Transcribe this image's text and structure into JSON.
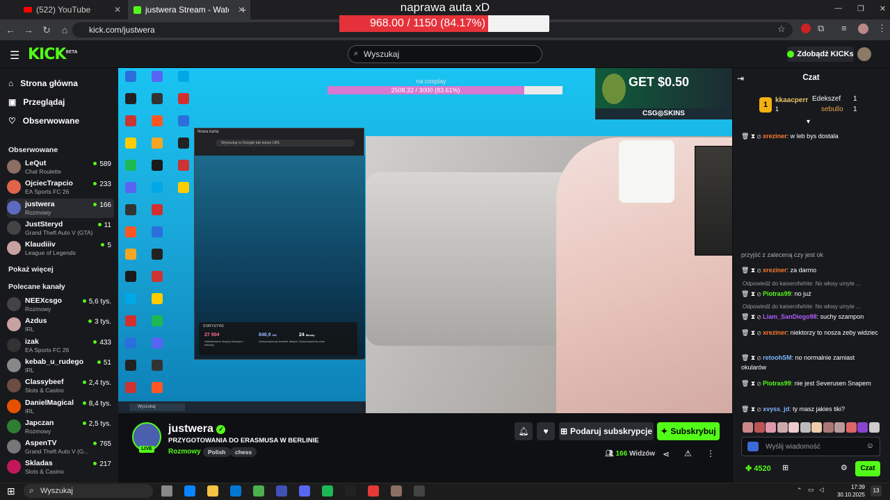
{
  "browser": {
    "tabs": [
      {
        "label": "(522) YouTube",
        "active": false
      },
      {
        "label": "justwera Stream - Watch Live o",
        "active": true
      }
    ],
    "new_tab_glyph": "+",
    "url": "kick.com/justwera"
  },
  "overlay_goal": {
    "title": "naprawa auta xD",
    "progress_text": "968.00 / 1150 (84.17%)",
    "progress": 0.8417,
    "bar_color": "#e5323a"
  },
  "kick": {
    "logo": "KICK",
    "logo_badge": "BETA",
    "search_placeholder": "Wyszukaj",
    "kicks_button": "Zdobądź KICKs",
    "accent": "#53fc18"
  },
  "sidebar": {
    "nav": [
      {
        "icon": "home-icon",
        "label": "Strona główna"
      },
      {
        "icon": "browse-icon",
        "label": "Przeglądaj"
      },
      {
        "icon": "heart-icon",
        "label": "Obserwowane"
      }
    ],
    "followed_heading": "Obserwowane",
    "followed": [
      {
        "name": "LeQut",
        "category": "Chat Roulette",
        "viewers": "589"
      },
      {
        "name": "OjciecTrapcio",
        "category": "EA Sports FC 26",
        "viewers": "233"
      },
      {
        "name": "justwera",
        "category": "Rozmowy",
        "viewers": "166"
      },
      {
        "name": "JustSteryd",
        "category": "Grand Theft Auto V (GTA)",
        "viewers": "11"
      },
      {
        "name": "Klaudiiiv",
        "category": "League of Legends",
        "viewers": "5"
      }
    ],
    "show_more": "Pokaż więcej",
    "recommended_heading": "Polecane kanały",
    "recommended": [
      {
        "name": "NEEXcsgo",
        "category": "Rozmowy",
        "viewers": "5,6 tys."
      },
      {
        "name": "Azdus",
        "category": "IRL",
        "viewers": "3 tys."
      },
      {
        "name": "izak",
        "category": "EA Sports FC 26",
        "viewers": "433"
      },
      {
        "name": "kebab_u_rudego",
        "category": "IRL",
        "viewers": "51"
      },
      {
        "name": "Classybeef",
        "category": "Slots & Casino",
        "viewers": "2,4 tys."
      },
      {
        "name": "DanielMagical",
        "category": "IRL",
        "viewers": "8,4 tys."
      },
      {
        "name": "Japczan",
        "category": "Rozmowy",
        "viewers": "2,5 tys."
      },
      {
        "name": "AspenTV",
        "category": "Grand Theft Auto V (G...",
        "viewers": "765"
      },
      {
        "name": "Skladas",
        "category": "Slots & Casino",
        "viewers": "217"
      }
    ]
  },
  "stream_inner": {
    "goal_title": "na cosplay",
    "goal_text": "2508.32 / 3000 (83.61%)",
    "goal_progress": 0.8361,
    "ad_title": "GET $0.50",
    "ad_brand": "CSG◎SKINS",
    "inner_browser_tab": "Nowa karta",
    "inner_search": "Wyszukaj w Google lub wpisz URL",
    "inner_taskbar_search": "Wyszukaj",
    "stats_title": "STATYSTYKI",
    "stats": [
      {
        "value": "27 904",
        "label": "Zablokowane skrypty śledzące i reklamy"
      },
      {
        "value": "848,9",
        "unit": "MB",
        "label": "Zaoszczędzony transfer danych"
      },
      {
        "value": "24",
        "unit": "Minuty",
        "label": "Zaoszczędzony czas"
      }
    ]
  },
  "channel": {
    "name": "justwera",
    "live_label": "LIVE",
    "title": "PRZYGOTOWANIA DO ERASMUSA W BERLINIE",
    "category": "Rozmowy",
    "tags": [
      "Polish",
      "chess"
    ],
    "gift_button": "Podaruj subskrypcje",
    "subscribe_button": "Subskrybuj",
    "viewers_count": "166",
    "viewers_label": "Widzów"
  },
  "chat": {
    "title": "Czat",
    "leaderboard": [
      {
        "rank": "1",
        "name": "kkaacperr",
        "count": "1"
      },
      {
        "name": "Edekszef",
        "count": "1"
      },
      {
        "name": "sebullo",
        "count": "1"
      }
    ],
    "messages": [
      {
        "user": "xreziner",
        "color": "#ff7a2e",
        "text": "w leb bys dostala"
      },
      {
        "partial": "przyjść z zaleceną czy jest ok"
      },
      {
        "user": "xreziner",
        "color": "#ff7a2e",
        "text": "za darmo"
      },
      {
        "reply": "Odpowiedź do kaiserofwhite: No włosy umyte ..."
      },
      {
        "user": "Piotras99",
        "color": "#53fc18",
        "text": "no już"
      },
      {
        "reply": "Odpowiedź do kaiserofwhite: No włosy umyte ..."
      },
      {
        "user": "Liam_SanDiego98",
        "color": "#b15cff",
        "text": "suchy szampon"
      },
      {
        "user": "xreziner",
        "color": "#ff7a2e",
        "text": "niektorzy to nosza zeby widziec"
      },
      {
        "user": "retoohSM",
        "color": "#7fb7ff",
        "text": "no normalnie zamiast okularów"
      },
      {
        "user": "Piotras99",
        "color": "#53fc18",
        "text": "nie jest Severusen Snapem"
      },
      {
        "user": "xvyss_jd",
        "color": "#7fb7ff",
        "text": "ty masz jakies tiki?"
      }
    ],
    "input_placeholder": "Wyślij wiadomość",
    "points": "4520",
    "send_button": "Czat"
  },
  "windows": {
    "search_placeholder": "Wyszukaj",
    "time": "17:39",
    "date": "30.10.2025",
    "notifications": "13"
  }
}
